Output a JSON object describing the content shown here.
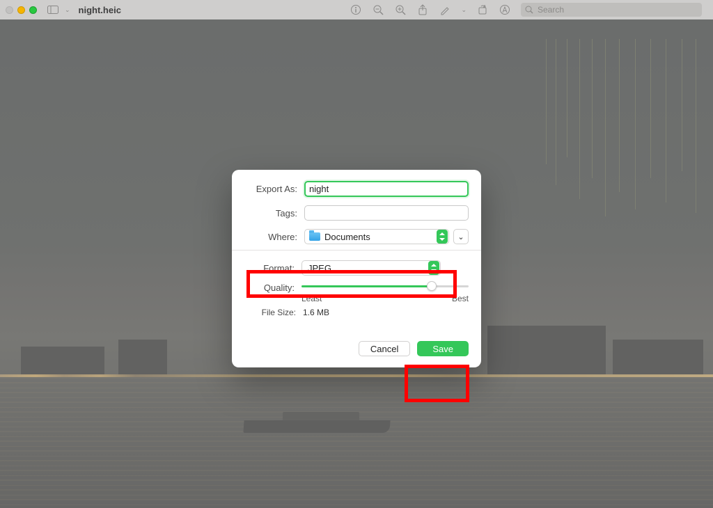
{
  "toolbar": {
    "title": "night.heic",
    "search_placeholder": "Search"
  },
  "sheet": {
    "export_as_label": "Export As:",
    "export_as_value": "night",
    "tags_label": "Tags:",
    "tags_value": "",
    "where_label": "Where:",
    "where_value": "Documents",
    "format_label": "Format:",
    "format_value": "JPEG",
    "quality_label": "Quality:",
    "quality_pct": 78,
    "quality_min_label": "Least",
    "quality_max_label": "Best",
    "filesize_label": "File Size:",
    "filesize_value": "1.6 MB",
    "cancel_label": "Cancel",
    "save_label": "Save"
  }
}
